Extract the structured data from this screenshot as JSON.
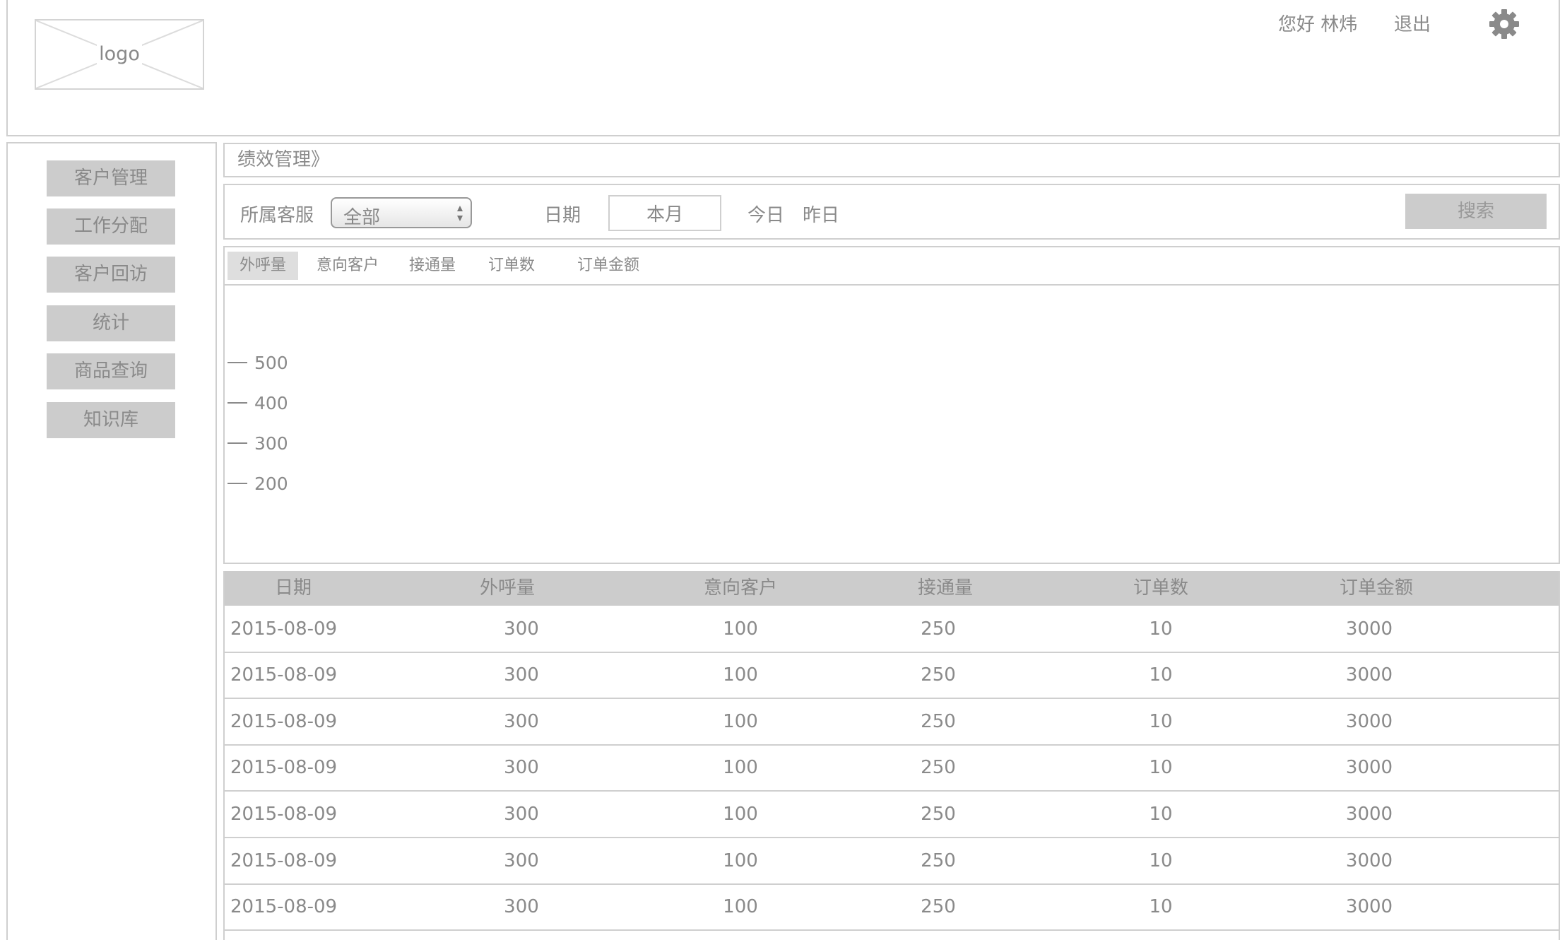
{
  "header": {
    "logo_text": "logo",
    "greeting": "您好 林炜",
    "logout": "退出"
  },
  "icons": {
    "settings": "gear-icon",
    "logo": "logo-placeholder-icon",
    "select": "chevron-updown-icon"
  },
  "sidebar": {
    "items": [
      {
        "label": "客户管理"
      },
      {
        "label": "工作分配"
      },
      {
        "label": "客户回访"
      },
      {
        "label": "统计"
      },
      {
        "label": "商品查询"
      },
      {
        "label": "知识库"
      }
    ]
  },
  "breadcrumb": "绩效管理》",
  "filter": {
    "service_label": "所属客服",
    "service_value": "全部",
    "date_label": "日期",
    "date_value": "本月",
    "today": "今日",
    "yesterday": "昨日",
    "search": "搜索"
  },
  "tabs": [
    {
      "label": "外呼量",
      "active": true
    },
    {
      "label": "意向客户",
      "active": false
    },
    {
      "label": "接通量",
      "active": false
    },
    {
      "label": "订单数",
      "active": false
    },
    {
      "label": "订单金额",
      "active": false
    }
  ],
  "chart_data": {
    "type": "line",
    "y_ticks": [
      500,
      400,
      300,
      200
    ],
    "series": []
  },
  "table": {
    "columns": [
      "日期",
      "外呼量",
      "意向客户",
      "接通量",
      "订单数",
      "订单金额"
    ],
    "rows": [
      [
        "2015-08-09",
        "300",
        "100",
        "250",
        "10",
        "3000"
      ],
      [
        "2015-08-09",
        "300",
        "100",
        "250",
        "10",
        "3000"
      ],
      [
        "2015-08-09",
        "300",
        "100",
        "250",
        "10",
        "3000"
      ],
      [
        "2015-08-09",
        "300",
        "100",
        "250",
        "10",
        "3000"
      ],
      [
        "2015-08-09",
        "300",
        "100",
        "250",
        "10",
        "3000"
      ],
      [
        "2015-08-09",
        "300",
        "100",
        "250",
        "10",
        "3000"
      ],
      [
        "2015-08-09",
        "300",
        "100",
        "250",
        "10",
        "3000"
      ]
    ]
  },
  "colors": {
    "border": "#cfcfcf",
    "button_bg": "#cccccc",
    "text": "#8a8a8a"
  }
}
